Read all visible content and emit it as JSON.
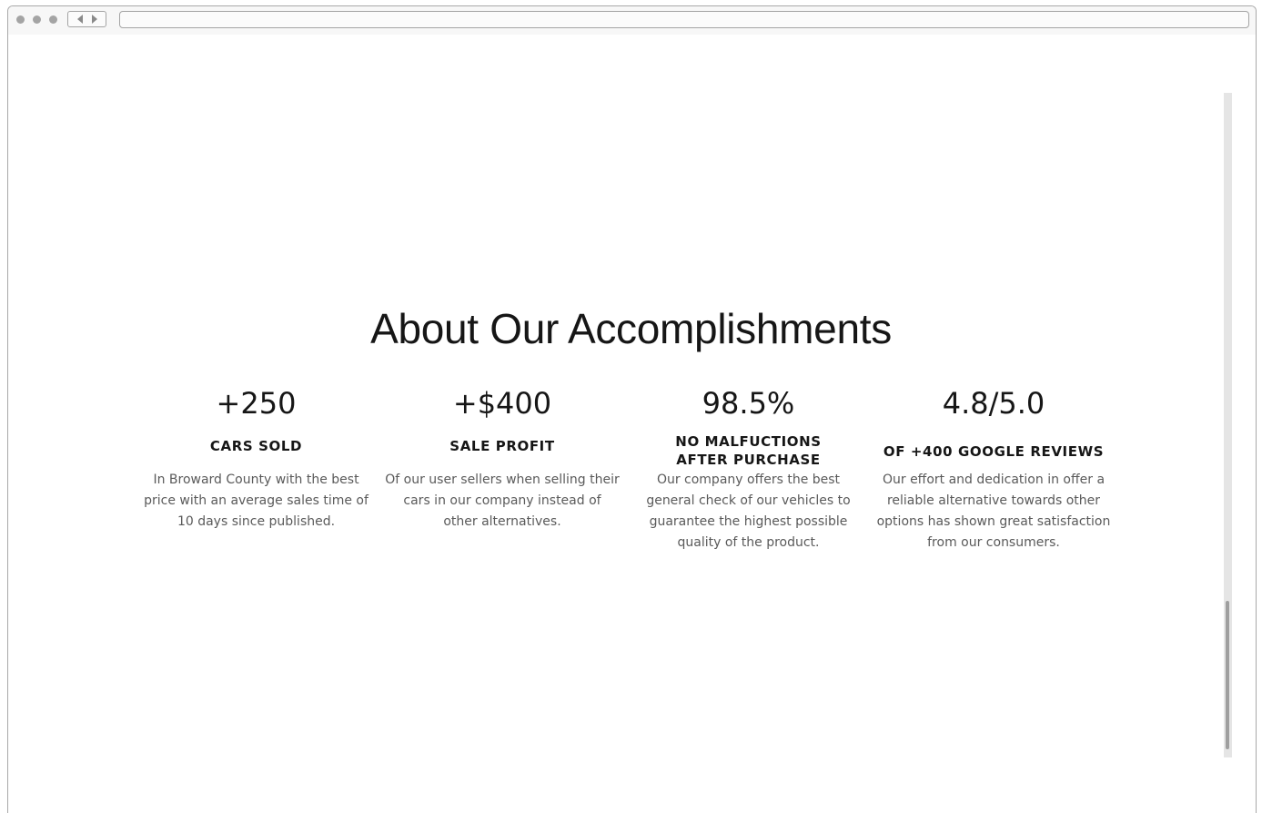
{
  "page": {
    "heading": "About Our Accomplishments"
  },
  "stats": [
    {
      "value": "+250",
      "label": "CARS SOLD",
      "description": "In Broward County with the best price  with an average sales time of 10 days since published."
    },
    {
      "value": "+$400",
      "label": "SALE PROFIT",
      "description": "Of our user sellers when selling their cars in our company instead of other alternatives."
    },
    {
      "value": "98.5%",
      "label": "NO MALFUCTIONS AFTER PURCHASE",
      "description": "Our company offers the best general check of our vehicles to guarantee the highest possible quality of the product."
    },
    {
      "value": "4.8/5.0",
      "label": "OF +400 GOOGLE REVIEWS",
      "description": "Our effort and dedication in offer a reliable alternative towards other options has shown great satisfaction from our consumers."
    }
  ],
  "colors": {
    "text_dark": "#161616",
    "text_muted": "#5a5a5a",
    "scroll_track": "#e5e5e5",
    "scroll_thumb": "#9f9f9f"
  }
}
